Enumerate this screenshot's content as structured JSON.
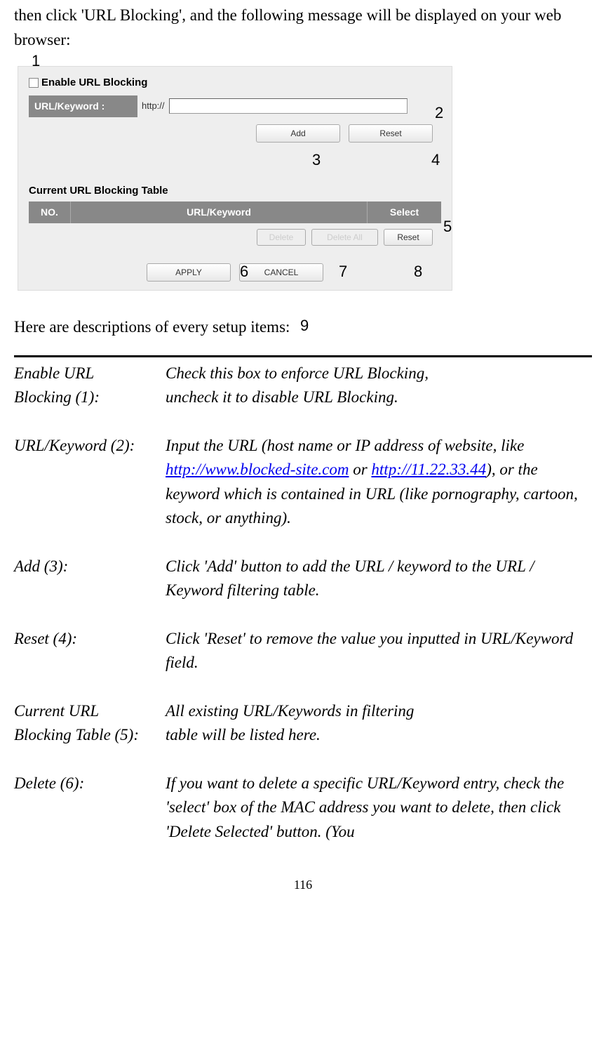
{
  "intro": "then click 'URL Blocking', and the following message will be displayed on your web browser:",
  "screenshot": {
    "enable_label": "Enable URL Blocking",
    "url_keyword_label": "URL/Keyword :",
    "prefix": "http://",
    "add_btn": "Add",
    "reset_btn": "Reset",
    "table_title": "Current URL Blocking Table",
    "th_no": "NO.",
    "th_url": "URL/Keyword",
    "th_select": "Select",
    "delete_btn": "Delete",
    "delete_all_btn": "Delete All",
    "reset2_btn": "Reset",
    "apply_btn": "APPLY",
    "cancel_btn": "CANCEL"
  },
  "annotations": {
    "a1": "1",
    "a2": "2",
    "a3": "3",
    "a4": "4",
    "a5": "5",
    "a6": "6",
    "a7": "7",
    "a8": "8",
    "a9": "9"
  },
  "desc_heading": "Here are descriptions of every setup items:",
  "items": {
    "enable": {
      "label1": "Enable URL",
      "label2": "Blocking (1):",
      "desc1": "Check this box to enforce URL Blocking,",
      "desc2": "uncheck it to disable URL Blocking."
    },
    "urlkw": {
      "label": "URL/Keyword (2):",
      "desc_a": "Input the URL (host name or IP address of website, like ",
      "link1": "http://www.blocked-site.com",
      "desc_b": " or ",
      "link2": "http://11.22.33.44",
      "desc_c": "), or the keyword which is contained in URL (like pornography, cartoon, stock, or anything)."
    },
    "add": {
      "label": "Add (3):",
      "desc": "Click 'Add' button to add the URL / keyword to the URL / Keyword filtering table."
    },
    "reset": {
      "label": "Reset (4):",
      "desc": "Click 'Reset' to remove the value you inputted in URL/Keyword field."
    },
    "table": {
      "label1": "Current URL",
      "label2": "Blocking Table (5):",
      "desc1": "All existing URL/Keywords in filtering",
      "desc2": "table will be listed here."
    },
    "delete": {
      "label": "Delete (6):",
      "desc": "If you want to delete a specific URL/Keyword entry, check the 'select' box of the MAC address you want to delete, then click 'Delete Selected' button. (You"
    }
  },
  "page_num": "116"
}
